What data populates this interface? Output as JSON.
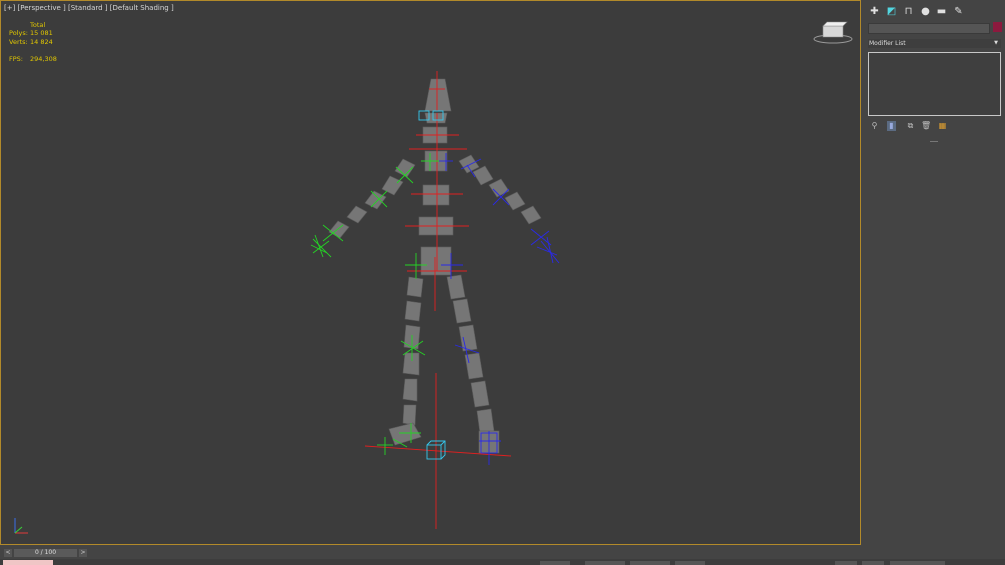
{
  "viewport": {
    "label": "[+] [Perspective ] [Standard ] [Default Shading ]",
    "stats_heading": "Total",
    "polys_label": "Polys:",
    "polys_value": "15 081",
    "verts_label": "Verts:",
    "verts_value": "14 824",
    "fps_label": "FPS:",
    "fps_value": "294,308"
  },
  "command_panel": {
    "tabs": [
      "create-icon",
      "modify-icon",
      "hierarchy-icon",
      "motion-icon",
      "display-icon",
      "utilities-icon"
    ],
    "modifier_list": "Modifier List",
    "object_color": "#8c1a3e"
  },
  "timeline": {
    "frame_display": "0 / 100"
  },
  "colors": {
    "viewport_border": "#b28a2a",
    "stats_text": "#e2c800",
    "center_bones": "#e02020",
    "left_bones": "#25d225",
    "right_bones": "#2a2ae8",
    "body_mesh": "#767676"
  }
}
